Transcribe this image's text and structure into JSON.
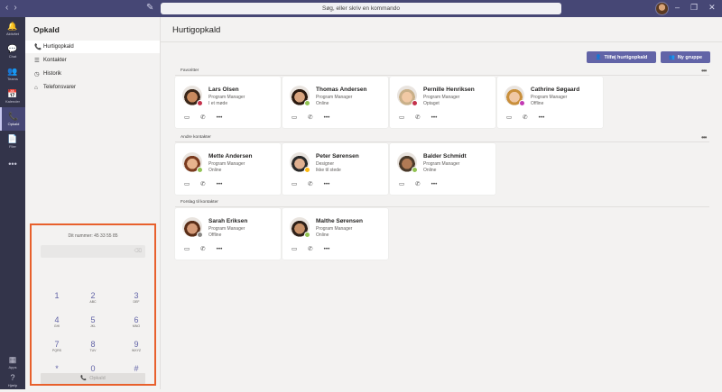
{
  "topbar": {
    "search_placeholder": "Søg, eller skriv en kommando",
    "back_arrow": "‹",
    "forward_arrow": "›",
    "compose_glyph": "✎",
    "minimize_glyph": "–",
    "maximize_glyph": "❐",
    "close_glyph": "✕"
  },
  "rail": {
    "items": [
      {
        "label": "Aktivitet",
        "icon": "🔔"
      },
      {
        "label": "Chat",
        "icon": "💬"
      },
      {
        "label": "Teams",
        "icon": "👥"
      },
      {
        "label": "Kalender",
        "icon": "📅"
      },
      {
        "label": "Opkald",
        "icon": "📞"
      },
      {
        "label": "Filer",
        "icon": "📄"
      },
      {
        "label": "",
        "icon": "•••"
      },
      {
        "label": "Apps",
        "icon": "▦"
      },
      {
        "label": "Hjælp",
        "icon": "?"
      }
    ]
  },
  "leftpanel": {
    "title": "Opkald",
    "items": [
      {
        "label": "Hurtigopkald",
        "icon": "📞"
      },
      {
        "label": "Kontakter",
        "icon": "☰"
      },
      {
        "label": "Historik",
        "icon": "◷"
      },
      {
        "label": "Telefonsvarer",
        "icon": "⌂"
      }
    ]
  },
  "dialpad": {
    "number_label": "Dit nummer: 45 33 55 85",
    "backspace": "⌫",
    "keys": [
      {
        "digit": "1",
        "letters": ""
      },
      {
        "digit": "2",
        "letters": "ABC"
      },
      {
        "digit": "3",
        "letters": "DEF"
      },
      {
        "digit": "4",
        "letters": "GHI"
      },
      {
        "digit": "5",
        "letters": "JKL"
      },
      {
        "digit": "6",
        "letters": "MNO"
      },
      {
        "digit": "7",
        "letters": "PQRS"
      },
      {
        "digit": "8",
        "letters": "TUV"
      },
      {
        "digit": "9",
        "letters": "WXYZ"
      },
      {
        "digit": "*",
        "letters": ""
      },
      {
        "digit": "0",
        "letters": "+"
      },
      {
        "digit": "#",
        "letters": ""
      }
    ],
    "call_label": "Opkald",
    "call_icon": "📞"
  },
  "main": {
    "title": "Hurtigopkald",
    "add_speed_dial_label": "Tilføj hurtigopkald",
    "new_group_label": "Ny gruppe",
    "more_glyph": "•••",
    "video_glyph": "▭",
    "phone_glyph": "✆",
    "sections": [
      {
        "label": "Favoritter",
        "contacts": [
          {
            "name": "Lars Olsen",
            "title": "Program Manager",
            "status": "I et møde",
            "status_color": "#c4314b",
            "skin": "#c98a5e",
            "hair": "#3a2618"
          },
          {
            "name": "Thomas Andersen",
            "title": "Program Manager",
            "status": "Online",
            "status_color": "#92c353",
            "skin": "#d8a47f",
            "hair": "#2b1a10"
          },
          {
            "name": "Pernille Henriksen",
            "title": "Program Manager",
            "status": "Optaget",
            "status_color": "#c4314b",
            "skin": "#f1c9a5",
            "hair": "#c9b089"
          },
          {
            "name": "Cathrine Søgaard",
            "title": "Program Manager",
            "status": "Offline",
            "status_color": "#c239b3",
            "skin": "#f0c7a4",
            "hair": "#c98f3b"
          }
        ]
      },
      {
        "label": "Andre kontakter",
        "contacts": [
          {
            "name": "Mette Andersen",
            "title": "Program Manager",
            "status": "Online",
            "status_color": "#92c353",
            "skin": "#e7b48e",
            "hair": "#7a3b1f"
          },
          {
            "name": "Peter Sørensen",
            "title": "Designer",
            "status": "Ikke til stede",
            "status_color": "#fdb913",
            "skin": "#e0b090",
            "hair": "#2a2a2a"
          },
          {
            "name": "Balder Schmidt",
            "title": "Program Manager",
            "status": "Online",
            "status_color": "#92c353",
            "skin": "#b07a55",
            "hair": "#4a3a2a"
          }
        ]
      },
      {
        "label": "Forslag til kontakter",
        "contacts": [
          {
            "name": "Sarah Eriksen",
            "title": "Program Manager",
            "status": "Offline",
            "status_color": "#8a8886",
            "skin": "#d59b78",
            "hair": "#5a2e18"
          },
          {
            "name": "Malthe Sørensen",
            "title": "Program Manager",
            "status": "Online",
            "status_color": "#92c353",
            "skin": "#c79068",
            "hair": "#2e2018"
          }
        ]
      }
    ]
  }
}
